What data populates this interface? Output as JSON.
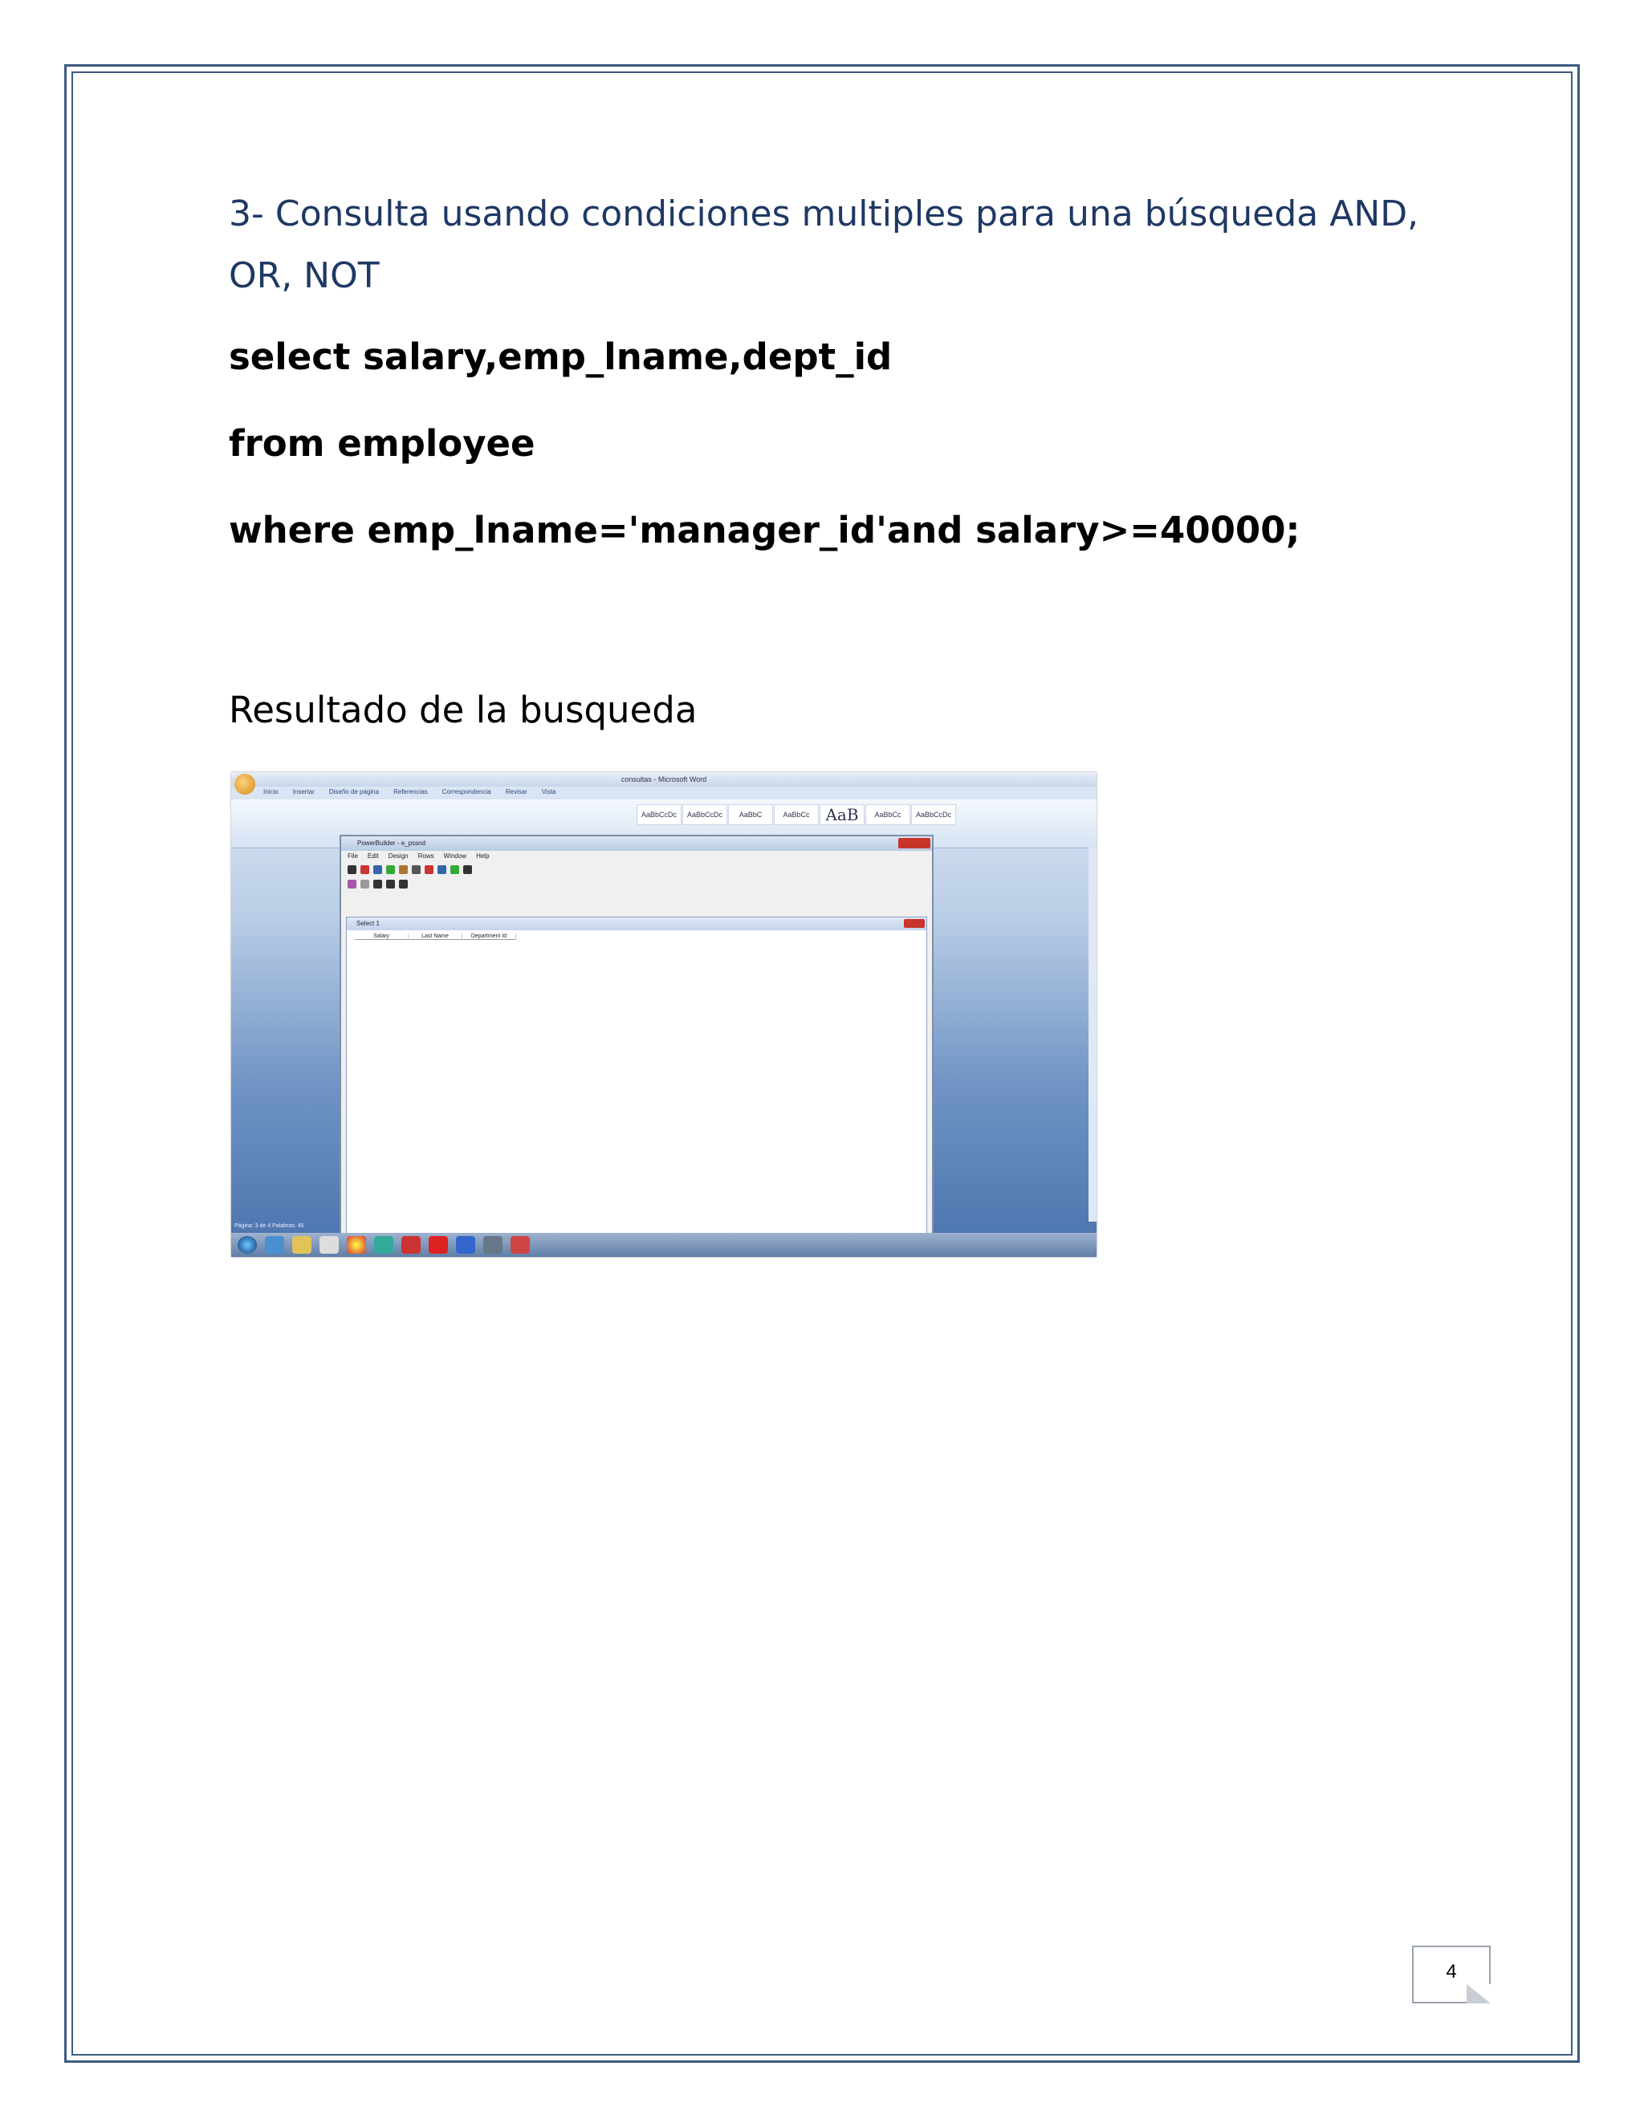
{
  "heading": "3- Consulta usando condiciones multiples para una búsqueda AND, OR, NOT",
  "sql": {
    "line1": "select  salary,emp_lname,dept_id",
    "line2": "from employee",
    "line3": "where emp_lname='manager_id'and salary>=40000;"
  },
  "result_label": "Resultado de la busqueda",
  "screenshot": {
    "window_title": "consultas - Microsoft Word",
    "ribbon_tabs": [
      "Inicio",
      "Insertar",
      "Diseño de página",
      "Referencias",
      "Correspondencia",
      "Revisar",
      "Vista"
    ],
    "style_samples": [
      "AaBbCcDc",
      "AaBbCcDc",
      "AaBbC",
      "AaBbCc",
      "AaB",
      "AaBbCc",
      "AaBbCcDc"
    ],
    "pb_title": "PowerBuilder - e_pssnd",
    "pb_menu": [
      "File",
      "Edit",
      "Design",
      "Rows",
      "Window",
      "Help"
    ],
    "doc_title": "Select 1",
    "columns": [
      "Salary",
      "Last Name",
      "Department Id"
    ],
    "status": "Página: 3 de 4    Palabras: 45"
  },
  "page_number": "4"
}
